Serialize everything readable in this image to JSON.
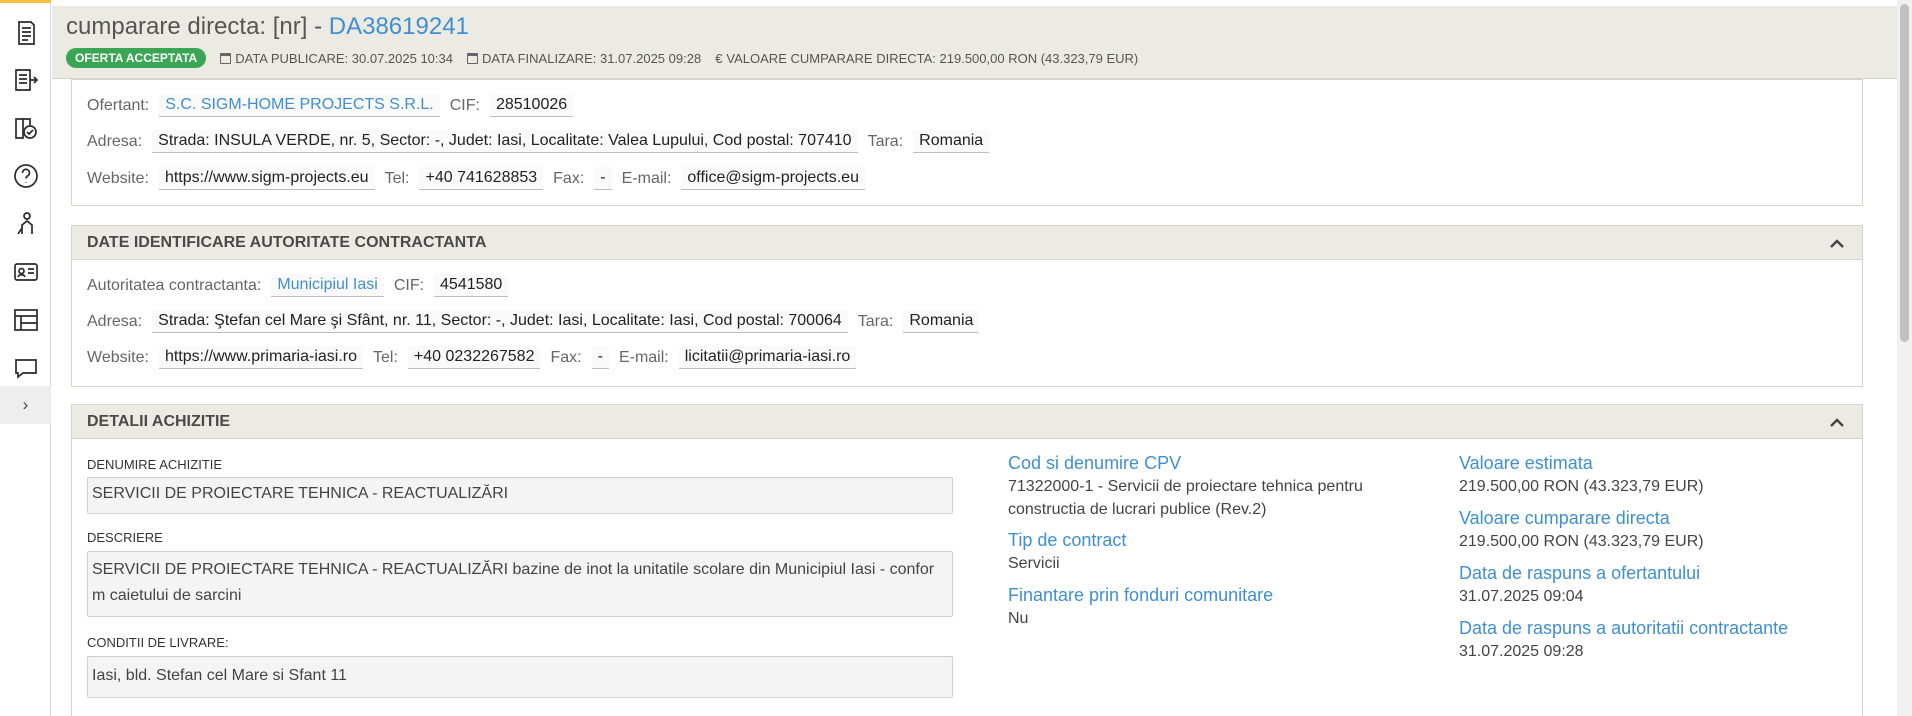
{
  "header": {
    "title_prefix": "cumparare directa: [nr] -",
    "code": "DA38619241",
    "status": "OFERTA ACCEPTATA",
    "publish_date": "DATA PUBLICARE: 30.07.2025 10:34",
    "end_date": "DATA FINALIZARE: 31.07.2025 09:28",
    "value": "VALOARE CUMPARARE DIRECTA: 219.500,00  RON (43.323,79  EUR)"
  },
  "ofertant": {
    "label": "Ofertant:",
    "name": "S.C. SIGM-HOME PROJECTS S.R.L.",
    "cif_label": "CIF:",
    "cif": "28510026",
    "address_label": "Adresa:",
    "address": "Strada: INSULA VERDE, nr. 5, Sector: -, Judet: Iasi, Localitate: Valea Lupului, Cod postal: 707410",
    "country_label": "Tara:",
    "country": "Romania",
    "website_label": "Website:",
    "website": "https://www.sigm-projects.eu",
    "tel_label": "Tel:",
    "tel": "+40 741628853",
    "fax_label": "Fax:",
    "fax": "-",
    "email_label": "E-mail:",
    "email": "office@sigm-projects.eu"
  },
  "autoritate": {
    "title": "DATE IDENTIFICARE AUTORITATE CONTRACTANTA",
    "label": "Autoritatea contractanta:",
    "name": "Municipiul Iasi",
    "cif_label": "CIF:",
    "cif": "4541580",
    "address_label": "Adresa:",
    "address": "Strada: Ştefan cel Mare şi Sfânt, nr. 11, Sector: -, Judet: Iasi, Localitate: Iasi, Cod postal: 700064",
    "country_label": "Tara:",
    "country": "Romania",
    "website_label": "Website:",
    "website": "https://www.primaria-iasi.ro",
    "tel_label": "Tel:",
    "tel": "+40 0232267582",
    "fax_label": "Fax:",
    "fax": "-",
    "email_label": "E-mail:",
    "email": "licitatii@primaria-iasi.ro"
  },
  "detalii": {
    "title": "DETALII ACHIZITIE",
    "denumire_label": "DENUMIRE ACHIZITIE",
    "denumire": "SERVICII DE PROIECTARE TEHNICA - REACTUALIZĂRI",
    "descriere_label": "DESCRIERE",
    "descriere": "SERVICII DE PROIECTARE TEHNICA - REACTUALIZĂRI bazine de inot la unitatile scolare din Municipiul Iasi - confor m caietului de sarcini",
    "livrare_label": "CONDITII DE LIVRARE:",
    "livrare": "Iasi, bld. Stefan cel Mare si Sfant 11",
    "cpv_title": "Cod si denumire CPV",
    "cpv": "71322000-1 - Servicii de proiectare tehnica pentru constructia de lucrari publice (Rev.2)",
    "tip_title": "Tip de contract",
    "tip": "Servicii",
    "fonduri_title": "Finantare prin fonduri comunitare",
    "fonduri": "Nu",
    "val_est_title": "Valoare estimata",
    "val_est": "219.500,00  RON (43.323,79  EUR)",
    "val_cd_title": "Valoare cumparare directa",
    "val_cd": "219.500,00  RON (43.323,79  EUR)",
    "raspuns_of_title": "Data de raspuns a ofertantului",
    "raspuns_of": "31.07.2025 09:04",
    "raspuns_ac_title": "Data de raspuns a autoritatii contractante",
    "raspuns_ac": "31.07.2025 09:28"
  },
  "colors": {
    "accent": "#f5c242",
    "link": "#3f8fd2",
    "status": "#3aa655",
    "panel_head": "#ecebe3"
  }
}
